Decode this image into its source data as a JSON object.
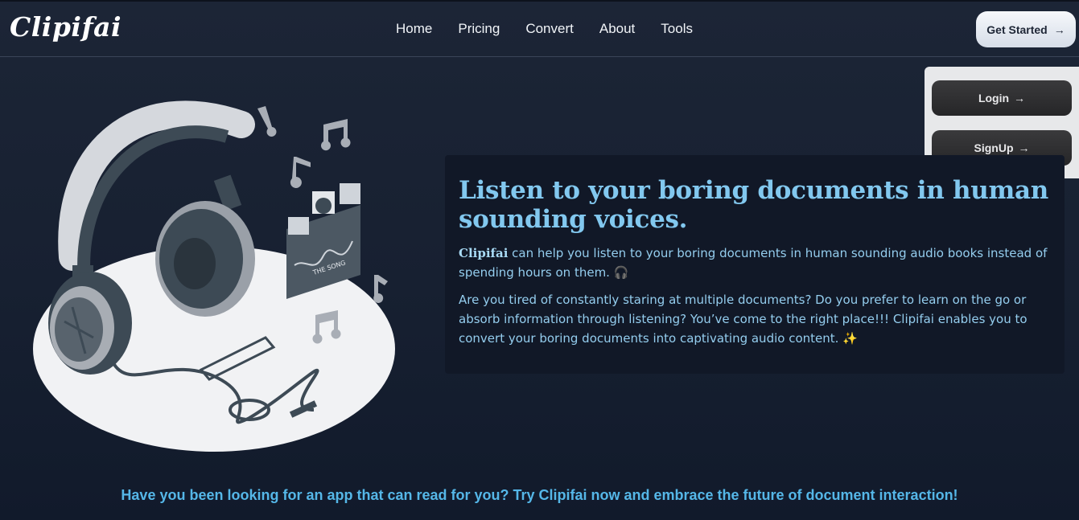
{
  "brand": {
    "logo_text": "Clipifai"
  },
  "nav": {
    "items": [
      {
        "label": "Home"
      },
      {
        "label": "Pricing"
      },
      {
        "label": "Convert"
      },
      {
        "label": "About"
      },
      {
        "label": "Tools"
      }
    ]
  },
  "header": {
    "get_started_label": "Get Started",
    "arrow": "→"
  },
  "dropdown": {
    "login_label": "Login",
    "signup_label": "SignUp",
    "arrow": "→"
  },
  "illustration": {
    "song_label": "THE SONG"
  },
  "hero": {
    "title": "Listen to your boring documents in human sounding voices.",
    "brand_word": "Clipifai",
    "p1_rest": " can help you listen to your boring documents in human sounding audio books instead of spending hours on them. 🎧",
    "p2": "Are you tired of constantly staring at multiple documents? Do you prefer to learn on the go or absorb information through listening? You’ve come to the right place!!! Clipifai enables you to convert your boring documents into captivating audio content. ✨"
  },
  "cta": {
    "text": "Have you been looking for an app that can read for you? Try Clipifai now and embrace the future of document interaction!"
  },
  "colors": {
    "background": "#1c2536",
    "accent_title": "#82c8ef",
    "accent_cta": "#55b7e8",
    "card": "#111827"
  }
}
